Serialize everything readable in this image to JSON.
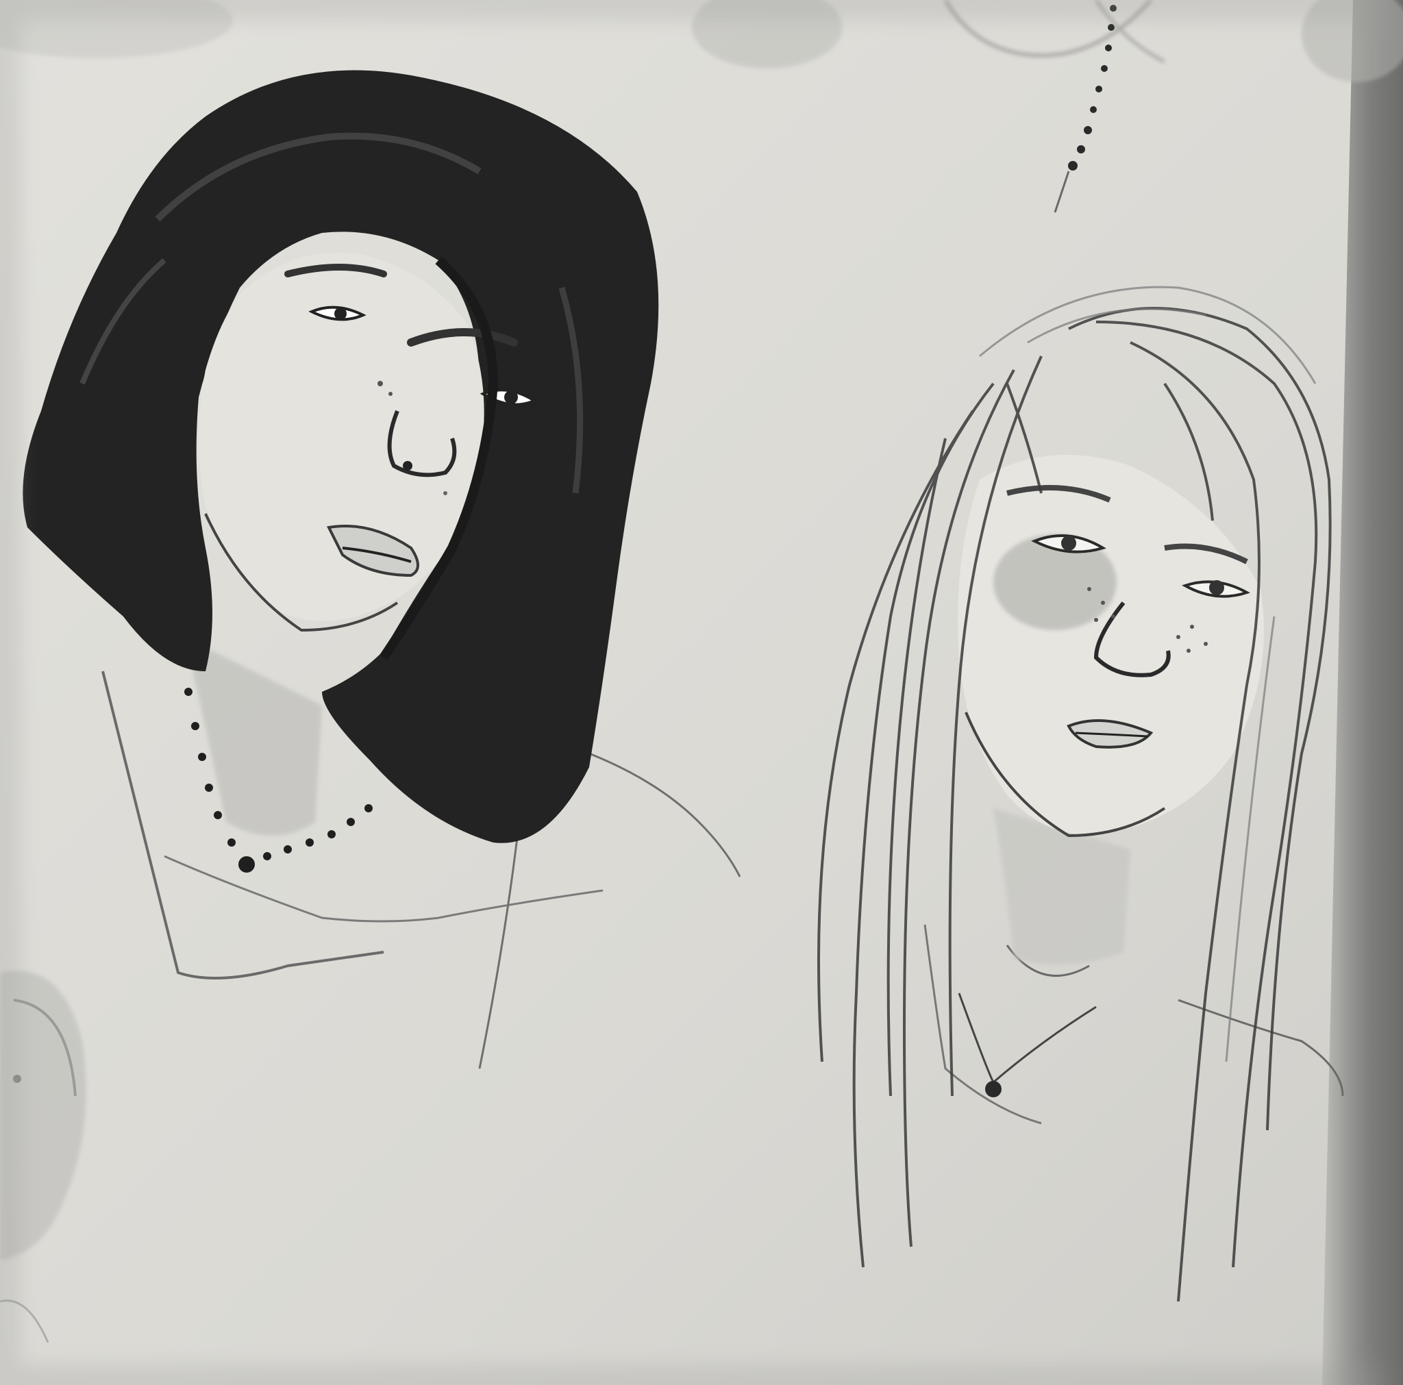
{
  "scene": {
    "colors": {
      "paper": "#dddcd7",
      "paper_shadow": "#c9c8c3",
      "screen_edge": "#6e6e6e",
      "ink_dark": "#1e1e1e",
      "ink_mid": "#505050",
      "graphite_light": "#8a8a8a",
      "wash": "#b8b8b5"
    }
  }
}
